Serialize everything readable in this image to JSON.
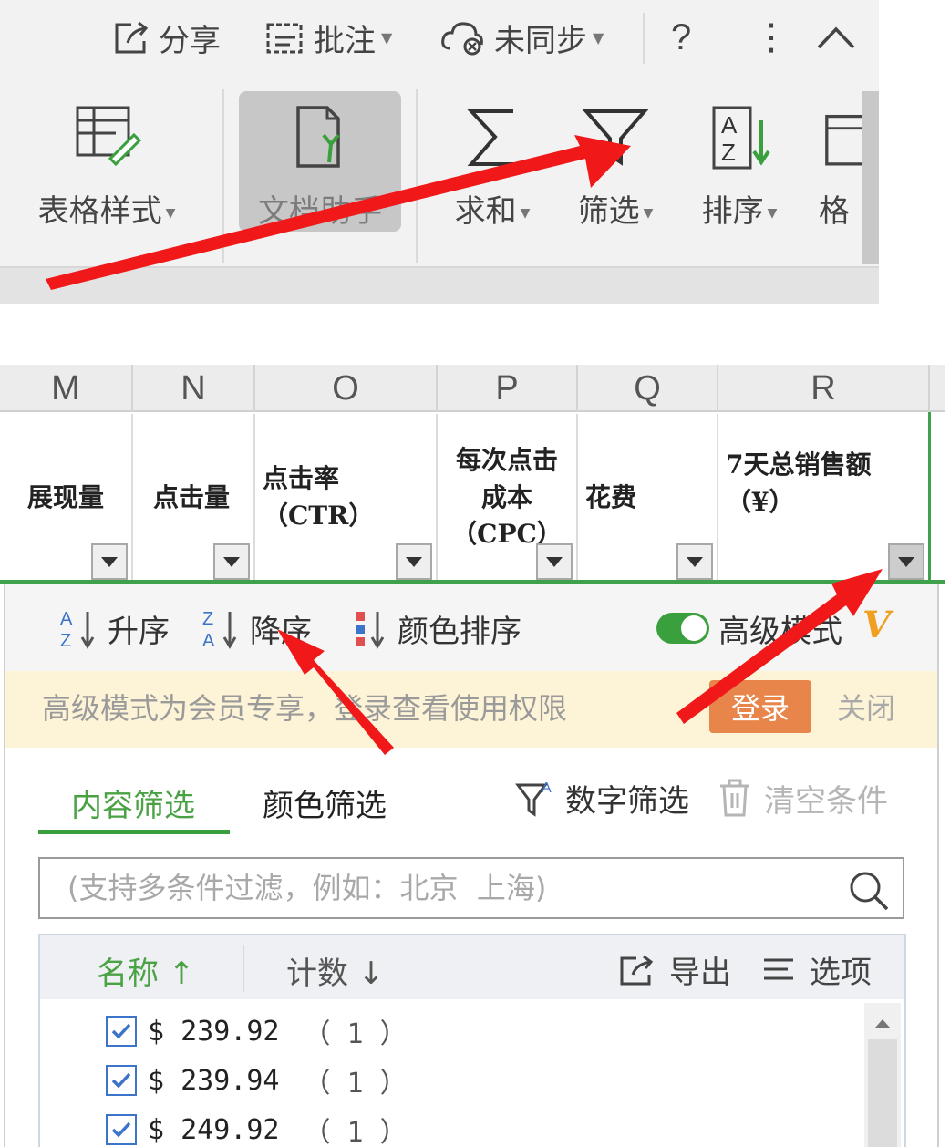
{
  "topbar": {
    "share_label": "分享",
    "comment_label": "批注",
    "sync_label": "未同步",
    "help_label": "?",
    "more_label": "⋮",
    "collapse_label": "^"
  },
  "ribbon": {
    "table_style": "表格样式",
    "doc_assistant": "文档助手",
    "sum": "求和",
    "filter": "筛选",
    "sort": "排序",
    "format_partial": "格"
  },
  "sheet": {
    "columns": [
      "M",
      "N",
      "O",
      "P",
      "Q",
      "R"
    ],
    "headers": {
      "M": "展现量",
      "N": "点击量",
      "O_line1": "点击率",
      "O_line2": "（CTR）",
      "P_line1": "每次点击",
      "P_line2": "成本",
      "P_line3": "（CPC）",
      "Q": "花费",
      "R_line1": "7天总销售额",
      "R_line2": "（¥）"
    }
  },
  "panel": {
    "sort": {
      "asc": "升序",
      "desc": "降序",
      "color_sort": "颜色排序",
      "advanced_mode": "高级模式",
      "vip_badge": "V"
    },
    "notice": {
      "text": "高级模式为会员专享，登录查看使用权限",
      "login": "登录",
      "close": "关闭"
    },
    "tabs": {
      "content_filter": "内容筛选",
      "color_filter": "颜色筛选",
      "number_filter": "数字筛选",
      "clear": "清空条件"
    },
    "search": {
      "placeholder": "(支持多条件过滤，例如：北京  上海)"
    },
    "list": {
      "name_header": "名称",
      "count_header": "计数",
      "export": "导出",
      "options": "选项",
      "items": [
        {
          "value": "$ 239.92",
          "count": "（ 1 ）",
          "checked": true
        },
        {
          "value": "$ 239.94",
          "count": "（ 1 ）",
          "checked": true
        },
        {
          "value": "$ 249.92",
          "count": "（ 1 ）",
          "checked": true
        }
      ]
    }
  },
  "colors": {
    "accent_green": "#3aa03e",
    "annotation_red": "#f01818",
    "login_orange": "#e8854a",
    "notice_bg": "#fdf3d6"
  }
}
